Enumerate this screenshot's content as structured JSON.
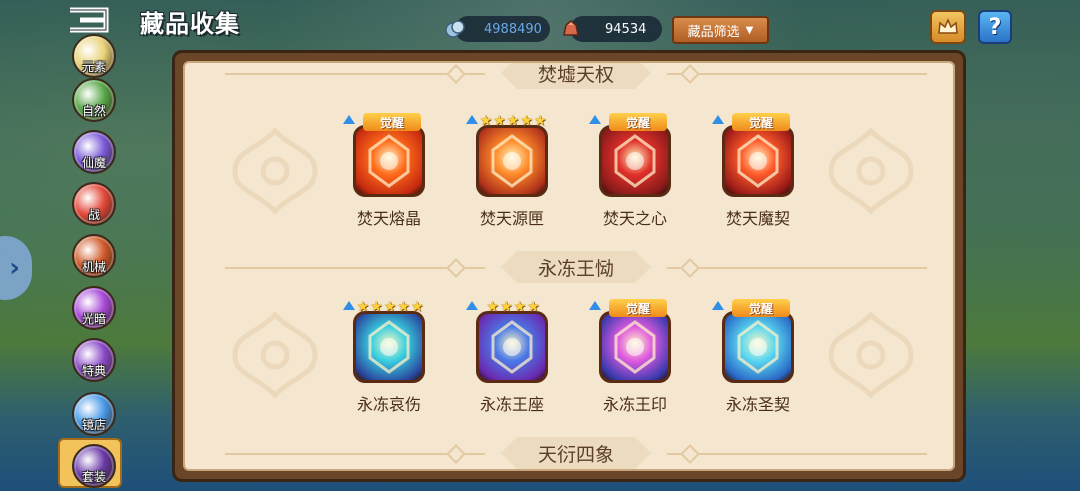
{
  "header": {
    "title": "藏品收集"
  },
  "resources": [
    {
      "icon": "crystal-icon",
      "value": "4988490"
    },
    {
      "icon": "gem-pouch-icon",
      "value": "94534"
    }
  ],
  "filter": {
    "label": "藏品筛选"
  },
  "help": {
    "label": "?"
  },
  "sidebar": [
    {
      "label": "元素",
      "color": "#e9d37a"
    },
    {
      "label": "自然",
      "color": "#5aa84a"
    },
    {
      "label": "仙魔",
      "color": "#7a5ad8"
    },
    {
      "label": "战",
      "color": "#e34a3a"
    },
    {
      "label": "机械",
      "color": "#d05a2a"
    },
    {
      "label": "光暗",
      "color": "#a84ad8"
    },
    {
      "label": "特典",
      "color": "#8a4ac8"
    },
    {
      "label": "镜店",
      "color": "#4a9ae8"
    },
    {
      "label": "套装",
      "color": "#6a3aa8"
    }
  ],
  "sections": [
    {
      "title": "焚墟天权",
      "items": [
        {
          "name": "焚天熔晶",
          "badge": "觉醒",
          "stars": 0,
          "colors": [
            "#ff6a1a",
            "#c52a10"
          ]
        },
        {
          "name": "焚天源匣",
          "badge": "",
          "stars": 5,
          "colors": [
            "#ff8a2a",
            "#b0321a"
          ]
        },
        {
          "name": "焚天之心",
          "badge": "觉醒",
          "stars": 0,
          "colors": [
            "#e0302a",
            "#8a1a1a"
          ]
        },
        {
          "name": "焚天魔契",
          "badge": "觉醒",
          "stars": 0,
          "colors": [
            "#ff5a2a",
            "#9a1a18"
          ]
        }
      ]
    },
    {
      "title": "永冻王恸",
      "items": [
        {
          "name": "永冻哀伤",
          "badge": "",
          "stars": 5,
          "colors": [
            "#3ad0e0",
            "#2a4aa0"
          ]
        },
        {
          "name": "永冻王座",
          "badge": "",
          "stars": 4,
          "colors": [
            "#4a7ae8",
            "#6a2ab0"
          ]
        },
        {
          "name": "永冻王印",
          "badge": "觉醒",
          "stars": 0,
          "colors": [
            "#e05ae0",
            "#3a3ab0"
          ]
        },
        {
          "name": "永冻圣契",
          "badge": "觉醒",
          "stars": 0,
          "colors": [
            "#5ad8f0",
            "#2a6ac8"
          ]
        }
      ]
    },
    {
      "title": "天衍四象",
      "items": []
    }
  ]
}
